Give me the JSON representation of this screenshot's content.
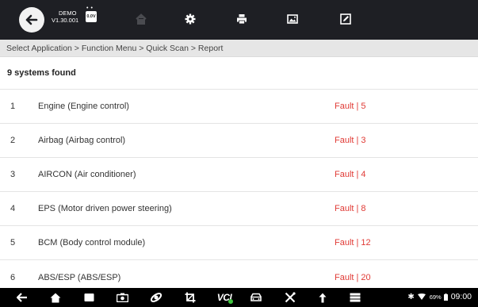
{
  "toolbar": {
    "demo_label": "DEMO",
    "version": "V1.30.001",
    "voltage": "0.0V",
    "icons": [
      "back-icon",
      "home-icon",
      "settings-gear-icon",
      "print-icon",
      "image-icon",
      "edit-icon"
    ]
  },
  "breadcrumb": "Select Application > Function Menu > Quick Scan > Report",
  "summary": "9 systems found",
  "rows": [
    {
      "num": "1",
      "name": "Engine (Engine control)",
      "status": "Fault | 5"
    },
    {
      "num": "2",
      "name": "Airbag (Airbag control)",
      "status": "Fault | 3"
    },
    {
      "num": "3",
      "name": "AIRCON (Air conditioner)",
      "status": "Fault | 4"
    },
    {
      "num": "4",
      "name": "EPS (Motor driven power steering)",
      "status": "Fault | 8"
    },
    {
      "num": "5",
      "name": "BCM (Body control module)",
      "status": "Fault | 12"
    },
    {
      "num": "6",
      "name": "ABS/ESP (ABS/ESP)",
      "status": "Fault | 20"
    }
  ],
  "navbar": {
    "vci_label": "VCI",
    "battery": "69%",
    "time": "09:00",
    "icons": [
      "back-arrow-icon",
      "home-icon",
      "recent-apps-icon",
      "camera-icon",
      "browser-icon",
      "crop-icon",
      "vci-icon",
      "car-icon",
      "tools-icon",
      "upload-icon",
      "menu-icon",
      "bluetooth-icon",
      "wifi-icon",
      "battery-icon"
    ]
  },
  "colors": {
    "toolbar_bg": "#1e1f24",
    "breadcrumb_bg": "#e6e6e6",
    "fault": "#e03a35",
    "navbar_bg": "#000000",
    "vci_connected": "#3ec43e"
  }
}
